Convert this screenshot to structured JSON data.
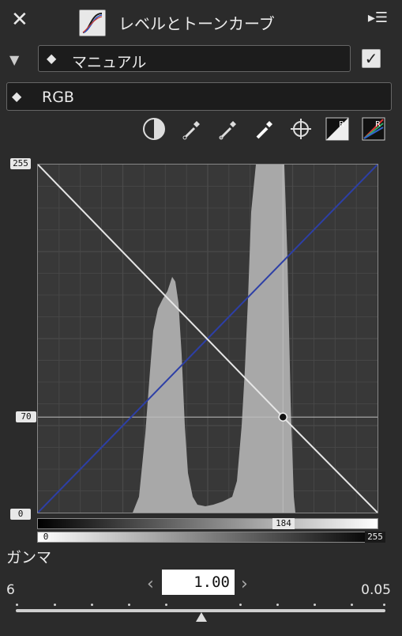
{
  "header": {
    "title": "レベルとトーンカーブ",
    "close_icon": "close-icon",
    "menu_icon": "panel-menu-icon"
  },
  "preset": {
    "label": "マニュアル",
    "enabled": true
  },
  "channel": {
    "label": "RGB"
  },
  "toolbar": [
    "contrast-icon",
    "black-point-eyedropper-icon",
    "gray-point-eyedropper-icon",
    "white-point-eyedropper-icon",
    "crosshair-icon",
    "auto-reset-icon",
    "auto-color-icon"
  ],
  "chart_data": {
    "type": "line",
    "xlim": [
      0,
      255
    ],
    "ylim": [
      0,
      255
    ],
    "y_labels": {
      "top": "255",
      "mid": "70",
      "bottom": "0"
    },
    "point": {
      "x": 184,
      "y": 70
    },
    "curve_white": {
      "points": [
        [
          0,
          255
        ],
        [
          184,
          70
        ],
        [
          255,
          0
        ]
      ]
    },
    "curve_blue": {
      "points": [
        [
          0,
          0
        ],
        [
          255,
          255
        ]
      ]
    },
    "histogram_peaks": "two",
    "colors": {
      "white_curve": "#e6e6e6",
      "blue_curve": "#2d3fa6",
      "histogram": "#a8a8a8",
      "grid": "#4a4a4a"
    }
  },
  "output_bar": {
    "marker": "184"
  },
  "input_bar": {
    "left": "0",
    "right": "255"
  },
  "gamma": {
    "label": "ガンマ",
    "min": "6",
    "max": "0.05",
    "value": "1.00"
  }
}
